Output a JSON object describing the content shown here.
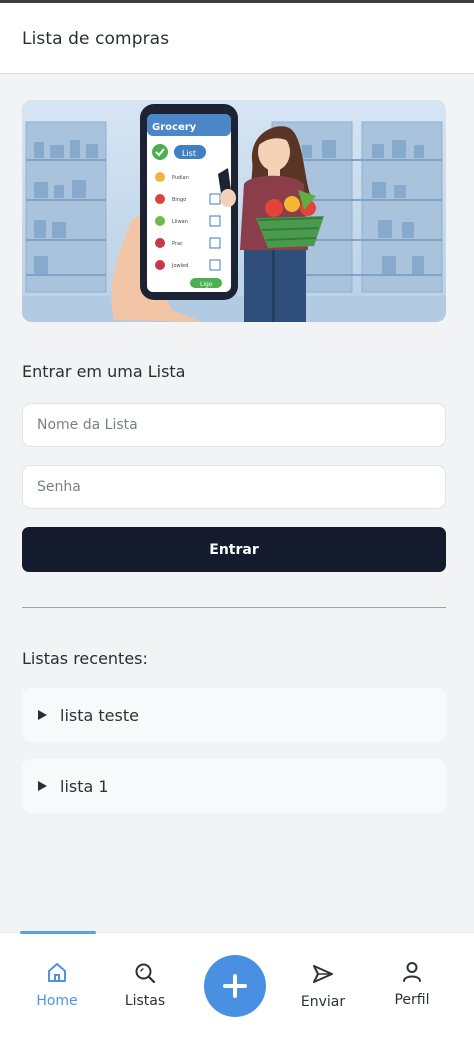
{
  "header": {
    "title": "Lista de compras"
  },
  "hero": {
    "phone_header": "Grocery",
    "phone_chip": "List",
    "phone_items": [
      "Pudian",
      "Bingo",
      "Lliwan",
      "Prac",
      "Jowled"
    ],
    "phone_footer_button": "Ligo"
  },
  "join": {
    "title": "Entrar em uma Lista",
    "name_placeholder": "Nome da Lista",
    "password_placeholder": "Senha",
    "enter_label": "Entrar"
  },
  "recent": {
    "title": "Listas recentes:",
    "items": [
      {
        "label": "lista teste"
      },
      {
        "label": "lista 1"
      }
    ]
  },
  "nav": {
    "items": [
      {
        "label": "Home",
        "icon": "home-icon",
        "active": true
      },
      {
        "label": "Listas",
        "icon": "search-icon"
      },
      {
        "label": "Enviar",
        "icon": "send-icon"
      },
      {
        "label": "Perfil",
        "icon": "user-icon"
      }
    ],
    "fab_icon": "plus-icon"
  },
  "colors": {
    "accent": "#4a90e2",
    "button_dark": "#131b2c",
    "background": "#f2f3f4"
  }
}
